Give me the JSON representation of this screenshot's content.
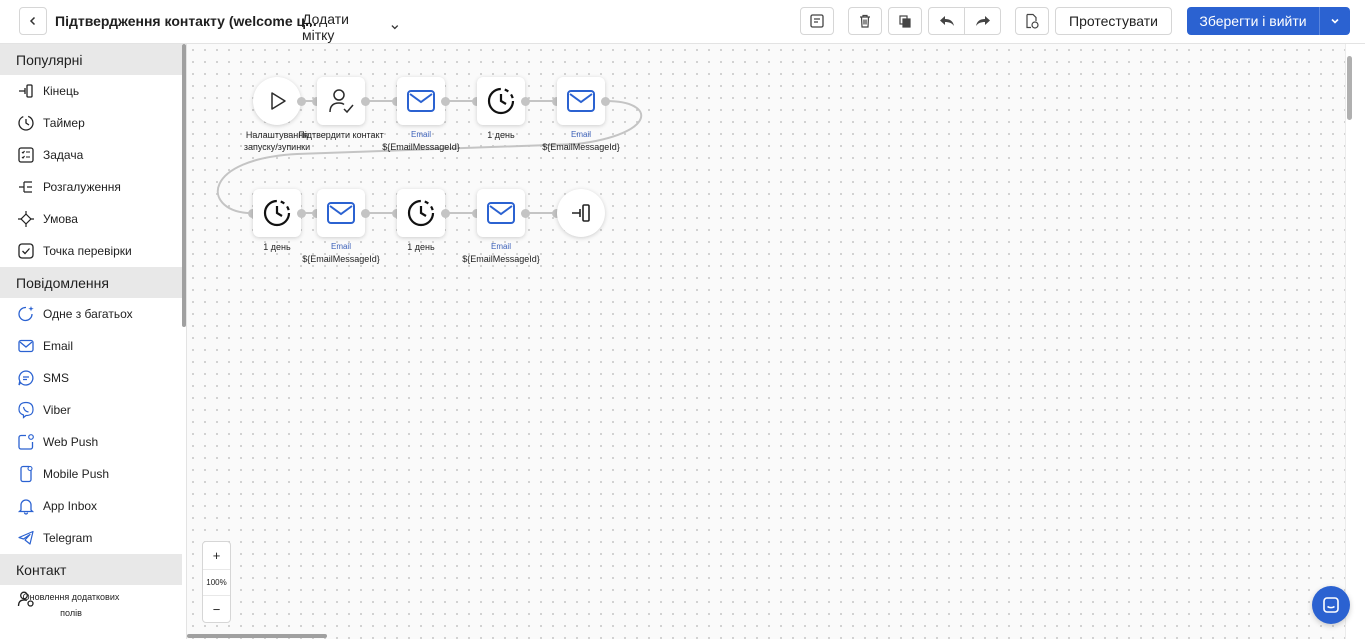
{
  "header": {
    "title": "Підтвердження контакту (welcome ц...",
    "tag_dropdown": "Додати мітку",
    "test_button": "Протестувати",
    "save_button": "Зберегти і вийти"
  },
  "sidebar": {
    "sections": [
      {
        "title": "Популярні",
        "items": [
          {
            "label": "Кінець",
            "icon": "exit-icon"
          },
          {
            "label": "Таймер",
            "icon": "timer-icon"
          },
          {
            "label": "Задача",
            "icon": "task-icon"
          },
          {
            "label": "Розгалуження",
            "icon": "branch-icon"
          },
          {
            "label": "Умова",
            "icon": "condition-icon"
          },
          {
            "label": "Точка перевірки",
            "icon": "checkpoint-icon"
          }
        ]
      },
      {
        "title": "Повідомлення",
        "items": [
          {
            "label": "Одне з багатьох",
            "icon": "sparkle-chat-icon"
          },
          {
            "label": "Email",
            "icon": "email-icon"
          },
          {
            "label": "SMS",
            "icon": "sms-icon"
          },
          {
            "label": "Viber",
            "icon": "viber-icon"
          },
          {
            "label": "Web Push",
            "icon": "web-push-icon"
          },
          {
            "label": "Mobile Push",
            "icon": "mobile-push-icon"
          },
          {
            "label": "App Inbox",
            "icon": "bell-icon"
          },
          {
            "label": "Telegram",
            "icon": "telegram-icon"
          }
        ]
      },
      {
        "title": "Контакт",
        "items": [
          {
            "label": "Оновлення додаткових полів",
            "icon": "user-settings-icon"
          }
        ]
      }
    ]
  },
  "flow": {
    "start_label_1": "Налаштування",
    "start_label_2": "запуску/зупинки",
    "confirm_label": "Підтвердити контакт",
    "email_type": "Email",
    "email_id": "${EmailMessageId}",
    "timer_label": "1 день"
  },
  "zoom": {
    "plus": "+",
    "level": "100%",
    "minus": "−"
  },
  "colors": {
    "accent": "#2b62d1",
    "email_icon": "#2b62d1"
  }
}
